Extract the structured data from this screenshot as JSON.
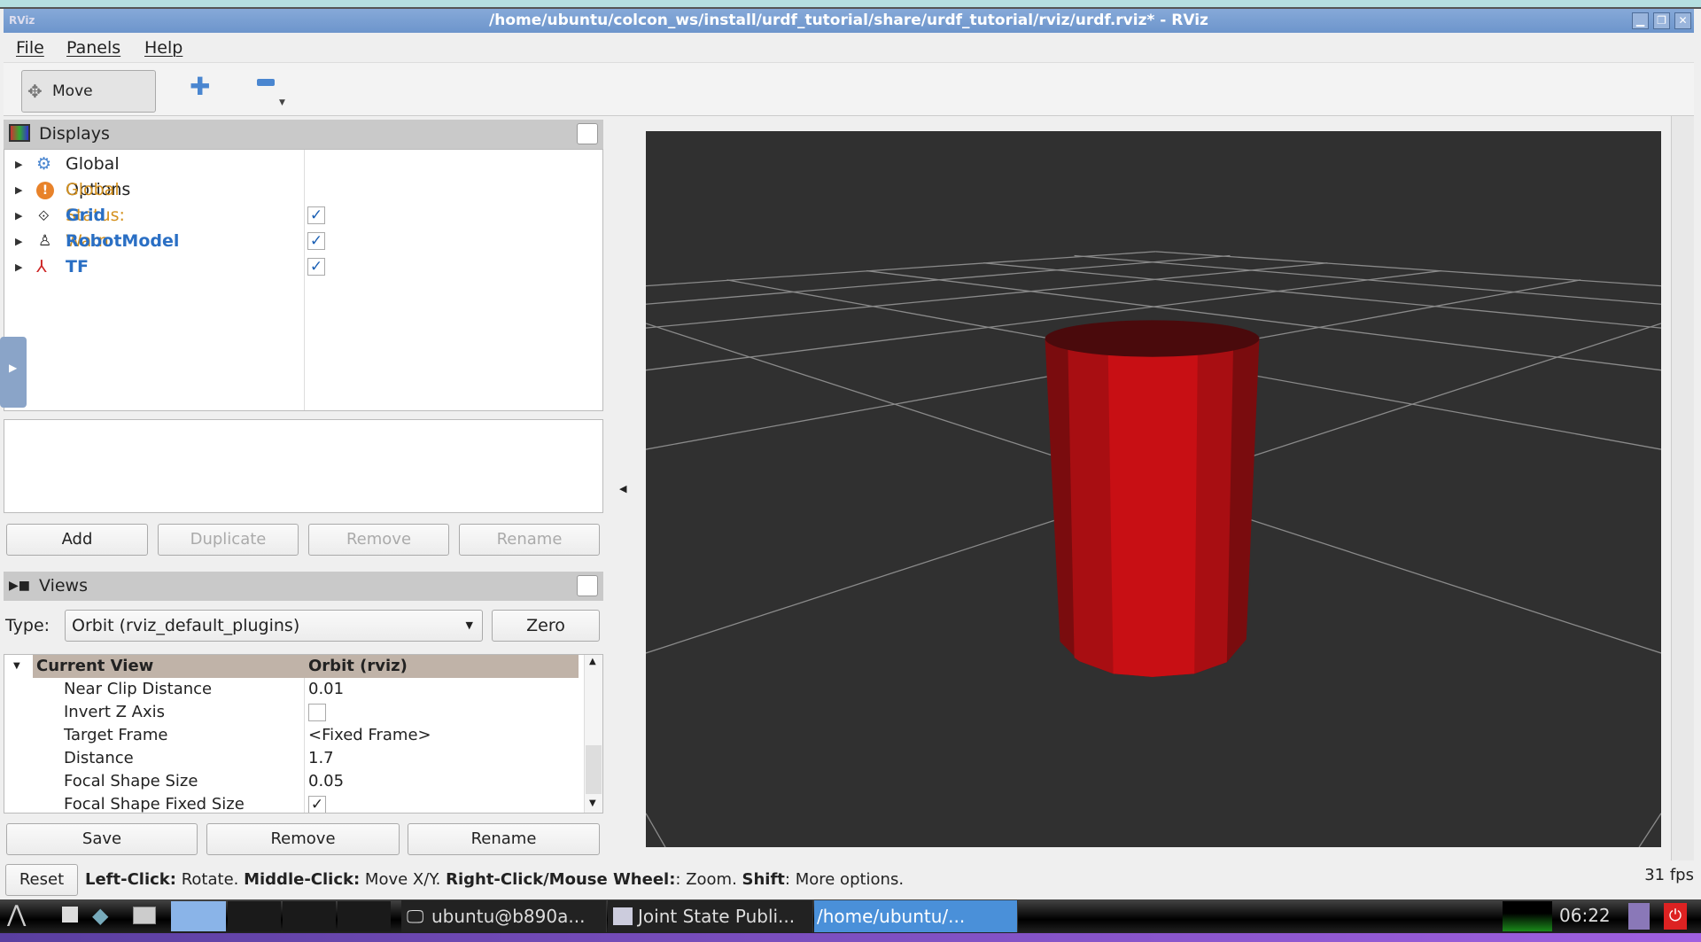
{
  "window": {
    "title": "/home/ubuntu/colcon_ws/install/urdf_tutorial/share/urdf_tutorial/rviz/urdf.rviz* - RViz",
    "logo": "RViz"
  },
  "menu": [
    "File",
    "Panels",
    "Help"
  ],
  "toolbar": {
    "move_camera": "Move Camera",
    "add_icon": "plus-icon",
    "remove_icon": "minus-icon"
  },
  "displays": {
    "title": "Displays",
    "items": [
      {
        "label": "Global Options",
        "icon": "gear-icon",
        "checked": null
      },
      {
        "label": "Global Status: Warn",
        "icon": "warning-icon",
        "checked": null,
        "color": "#d4911e"
      },
      {
        "label": "Grid",
        "icon": "grid-icon",
        "checked": true
      },
      {
        "label": "RobotModel",
        "icon": "robot-icon",
        "checked": true
      },
      {
        "label": "TF",
        "icon": "axes-icon",
        "checked": true
      }
    ],
    "buttons": {
      "add": "Add",
      "duplicate": "Duplicate",
      "remove": "Remove",
      "rename": "Rename"
    }
  },
  "views": {
    "title": "Views",
    "type_label": "Type:",
    "type_value": "Orbit (rviz_default_plugins)",
    "zero": "Zero",
    "header": {
      "name": "Current View",
      "value": "Orbit (rviz)"
    },
    "props": [
      {
        "name": "Near Clip Distance",
        "value": "0.01"
      },
      {
        "name": "Invert Z Axis",
        "value": "",
        "checkbox": false
      },
      {
        "name": "Target Frame",
        "value": "<Fixed Frame>"
      },
      {
        "name": "Distance",
        "value": "1.7"
      },
      {
        "name": "Focal Shape Size",
        "value": "0.05"
      },
      {
        "name": "Focal Shape Fixed Size",
        "value": "",
        "checkbox": true
      }
    ],
    "buttons": {
      "save": "Save",
      "remove": "Remove",
      "rename": "Rename"
    }
  },
  "status": {
    "reset": "Reset",
    "h1": "Left-Click:",
    "t1": " Rotate. ",
    "h2": "Middle-Click:",
    "t2": " Move X/Y. ",
    "h3": "Right-Click/Mouse Wheel:",
    "t3": ": Zoom. ",
    "h4": "Shift",
    "t4": ": More options.",
    "fps": "31 fps"
  },
  "taskbar": {
    "tasks": [
      "ubuntu@b890a...",
      "Joint State Publi...",
      "/home/ubuntu/..."
    ],
    "clock": "06:22"
  },
  "colors": {
    "viewport_bg": "#303030",
    "cylinder": "#c80f14",
    "link": "#2a6fc4"
  }
}
